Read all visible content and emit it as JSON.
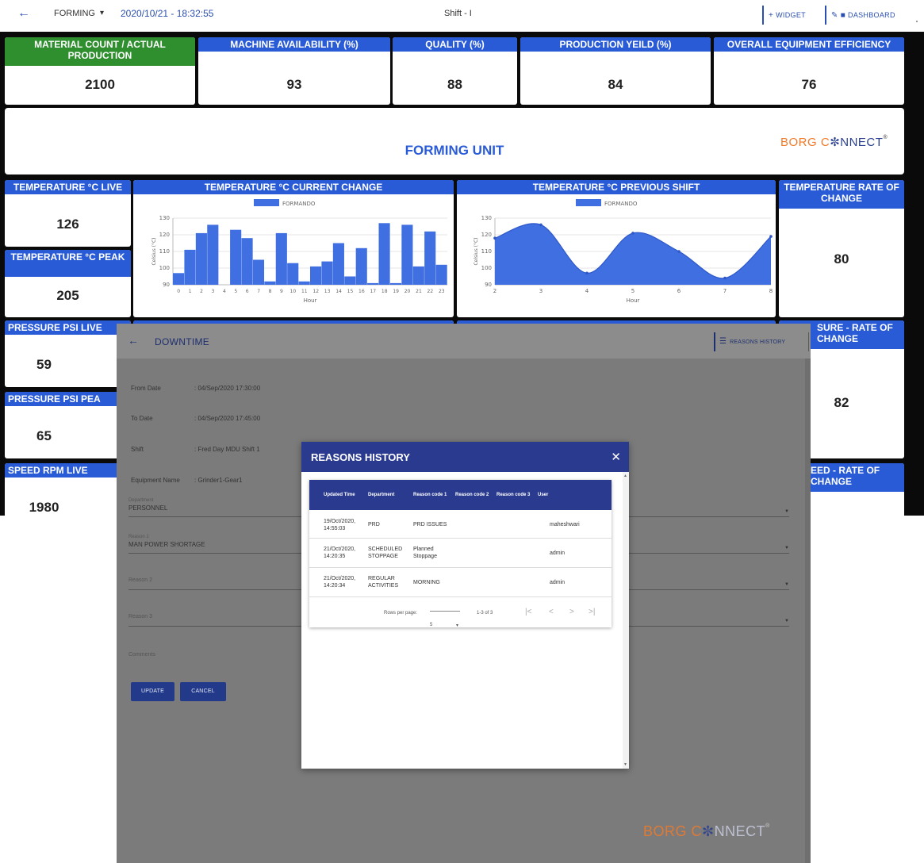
{
  "topbar": {
    "back_icon": "arrow-left-icon",
    "unit": "FORMING",
    "datetime": "2020/10/21 - 18:32:55",
    "shift": "Shift - I",
    "widget_label": "WIDGET",
    "dashboard_label": "DASHBOARD"
  },
  "kpis": {
    "material": {
      "label": "MATERIAL COUNT / ACTUAL PRODUCTION",
      "value": "2100"
    },
    "availability": {
      "label": "MACHINE AVAILABILITY (%)",
      "value": "93"
    },
    "quality": {
      "label": "QUALITY (%)",
      "value": "88"
    },
    "yield": {
      "label": "PRODUCTION YEILD (%)",
      "value": "84"
    },
    "oee": {
      "label": "OVERALL EQUIPMENT EFFICIENCY",
      "value": "76"
    }
  },
  "banner": {
    "title": "FORMING UNIT",
    "logo_part1": "BORG C",
    "logo_part2": "NNECT",
    "logo_mark": "®"
  },
  "tiles": {
    "temp_live": {
      "label": "TEMPERATURE °C LIVE",
      "value": "126"
    },
    "temp_peak": {
      "label": "TEMPERATURE °C PEAK",
      "value": "205"
    },
    "temp_rate": {
      "label": "TEMPERATURE RATE OF CHANGE",
      "value": "80"
    },
    "press_live": {
      "label": "PRESSURE PSI LIVE",
      "value": "59"
    },
    "press_peak": {
      "label": "PRESSURE PSI PEA",
      "value": "65"
    },
    "press_rate": {
      "label": "SURE - RATE OF CHANGE",
      "value": "82"
    },
    "speed_live": {
      "label": "SPEED RPM LIVE",
      "value": "1980"
    },
    "speed_rate": {
      "label": "EED - RATE OF CHANGE"
    }
  },
  "charts": {
    "current": {
      "title": "TEMPERATURE °C CURRENT CHANGE",
      "legend": "FORMANDO",
      "ylabel": "Celsius (°C)",
      "xlabel": "Hour"
    },
    "previous": {
      "title": "TEMPERATURE °C PREVIOUS SHIFT",
      "legend": "FORMANDO",
      "ylabel": "Celsius (°C)",
      "xlabel": "Hour"
    }
  },
  "chart_data": [
    {
      "type": "bar",
      "title": "TEMPERATURE °C CURRENT CHANGE",
      "xlabel": "Hour",
      "ylabel": "Celsius (°C)",
      "legend": [
        "FORMANDO"
      ],
      "ylim": [
        90,
        130
      ],
      "yticks": [
        90,
        100,
        110,
        120,
        130
      ],
      "categories": [
        "0",
        "1",
        "2",
        "3",
        "4",
        "5",
        "6",
        "7",
        "8",
        "9",
        "10",
        "11",
        "12",
        "13",
        "14",
        "15",
        "16",
        "17",
        "18",
        "19",
        "20",
        "21",
        "22",
        "23"
      ],
      "values": [
        97,
        111,
        121,
        126,
        90,
        123,
        118,
        105,
        92,
        121,
        103,
        92,
        101,
        104,
        115,
        95,
        112,
        91,
        127,
        91,
        126,
        101,
        122,
        102
      ],
      "color": "#3f6fe0"
    },
    {
      "type": "area",
      "title": "TEMPERATURE °C PREVIOUS SHIFT",
      "xlabel": "Hour",
      "ylabel": "Celsius (°C)",
      "legend": [
        "FORMANDO"
      ],
      "xlim": [
        2,
        8
      ],
      "ylim": [
        90,
        130
      ],
      "yticks": [
        90,
        100,
        110,
        120,
        130
      ],
      "x": [
        2,
        3,
        4,
        5,
        6,
        7,
        8
      ],
      "y": [
        118,
        126,
        97,
        121,
        110,
        94,
        119
      ],
      "color": "#3f6fe0"
    }
  ],
  "downtime": {
    "back_icon": "arrow-left-icon",
    "title": "DOWNTIME",
    "reasons_history_button": "REASONS HISTORY",
    "from_date_label": "From Date",
    "from_date_value": ": 04/Sep/2020 17:30:00",
    "to_date_label": "To Date",
    "to_date_value": ": 04/Sep/2020 17:45:00",
    "shift_label": "Shift",
    "shift_value": ": Fred Day MDU Shift 1",
    "equipment_label": "Equipment Name",
    "equipment_value": ": Grinder1-Gear1",
    "department_label": "Department",
    "department_value": "PERSONNEL",
    "reason1_label": "Reason 1",
    "reason1_value": "MAN POWER SHORTAGE",
    "reason2_label": "Reason 2",
    "reason3_label": "Reason 3",
    "comments_label": "Comments",
    "update_button": "UPDATE",
    "cancel_button": "CANCEL"
  },
  "dialog": {
    "title": "REASONS HISTORY",
    "columns": [
      "Updated Time",
      "Department",
      "Reason code 1",
      "Reason code 2",
      "Reason code 3",
      "User"
    ],
    "rows": [
      {
        "time": "19/Oct/2020, 14:55:03",
        "dept": "PRD",
        "r1": "PRD ISSUES",
        "user": "maheshwari"
      },
      {
        "time": "21/Oct/2020, 14:20:35",
        "dept": "SCHEDULED STOPPAGE",
        "r1": "Planned Stoppage",
        "user": "admin"
      },
      {
        "time": "21/Oct/2020, 14:20:34",
        "dept": "REGULAR ACTIVITIES",
        "r1": "MORNING",
        "user": "admin"
      }
    ],
    "rows_per_page_label": "Rows per page:",
    "rows_per_page_value": "5",
    "page_range": "1-3 of 3"
  }
}
